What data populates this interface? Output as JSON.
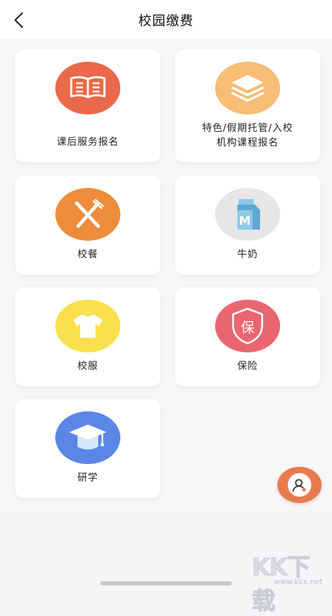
{
  "header": {
    "title": "校园缴费"
  },
  "items": [
    {
      "label": "课后服务报名",
      "icon": "book-icon",
      "color": "#e9694a"
    },
    {
      "label_lines": [
        "特色/假期托管/入校",
        "机构课程报名"
      ],
      "icon": "layers-icon",
      "color": "#f6bd77"
    },
    {
      "label": "校餐",
      "icon": "fork-knife-icon",
      "color": "#ef8c3b"
    },
    {
      "label": "牛奶",
      "icon": "milk-carton-icon",
      "color": "#e6e6e8"
    },
    {
      "label": "校服",
      "icon": "tshirt-icon",
      "color": "#f9e04c"
    },
    {
      "label": "保险",
      "icon": "shield-icon",
      "icon_text": "保",
      "color": "#e96670"
    },
    {
      "label": "研学",
      "icon": "graduation-cap-icon",
      "color": "#5b86e5"
    }
  ],
  "fab": {
    "icon": "user-icon",
    "color": "#e97a4b"
  },
  "watermark": {
    "big": "KK下载",
    "small": "www.kkx.net"
  }
}
